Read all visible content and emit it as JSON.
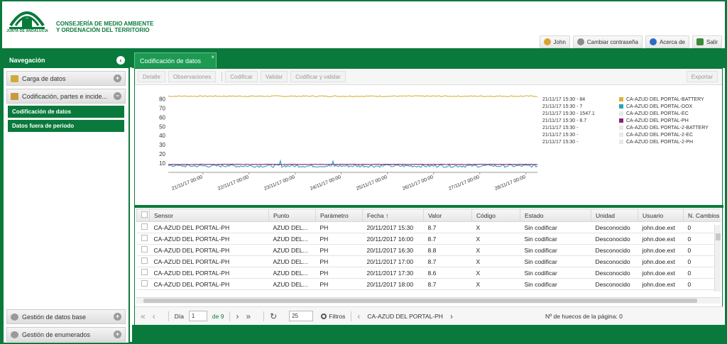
{
  "header": {
    "logo_caption": "JUNTA DE ANDALUCIA",
    "org_line1": "CONSEJERÍA DE MEDIO AMBIENTE",
    "org_line2": "Y ORDENACIÓN DEL TERRITORIO",
    "user": "John",
    "change_password": "Cambiar contraseña",
    "about": "Acerca de",
    "logout": "Salir"
  },
  "sidebar": {
    "title": "Navegación",
    "sections": [
      {
        "label": "Carga de datos",
        "state": "+"
      },
      {
        "label": "Codificación, partes e incide...",
        "state": "−"
      }
    ],
    "links": [
      "Codificación de datos",
      "Datos fuera de periodo"
    ],
    "bottom_sections": [
      {
        "label": "Gestión de datos base",
        "state": "+"
      },
      {
        "label": "Gestión de enumerados",
        "state": "+"
      }
    ]
  },
  "tab": {
    "label": "Codificación de datos",
    "close": "×"
  },
  "toolbar": {
    "detalle": "Detalle",
    "observaciones": "Observaciones",
    "codificar": "Codificar",
    "validar": "Validar",
    "codificar_validar": "Codificar y validar",
    "exportar": "Exportar"
  },
  "chart_data": {
    "type": "line",
    "y_ticks": [
      "80",
      "70",
      "60",
      "50",
      "40",
      "30",
      "20",
      "10"
    ],
    "ylim": [
      0,
      85
    ],
    "x_ticks": [
      "21/11/17 00:00",
      "22/11/17 00:00",
      "23/11/17 00:00",
      "24/11/17 00:00",
      "25/11/17 00:00",
      "26/11/17 00:00",
      "27/11/17 00:00",
      "28/11/17 00:00"
    ],
    "series": [
      {
        "name": "CA-AZUD DEL PORTAL-BATTERY",
        "last": "21/11/17 15:30 - 84",
        "color": "#d9b43a",
        "approx_level": 83
      },
      {
        "name": "CA-AZUD DEL PORTAL-DOX",
        "last": "21/11/17 15:30 - 7",
        "color": "#2e9fb8",
        "approx_level": 7
      },
      {
        "name": "CA-AZUD DEL PORTAL-EC",
        "last": "21/11/17 15:30 - 1547.1",
        "color": "#e8e8e8",
        "approx_level": null
      },
      {
        "name": "CA-AZUD DEL PORTAL-PH",
        "last": "21/11/17 15:30 - 8.7",
        "color": "#8b1f7a",
        "approx_level": 8.7
      },
      {
        "name": "CA-AZUD DEL PORTAL-2-BATTERY",
        "last": "21/11/17 15:30 -",
        "color": "#e8e8e8",
        "approx_level": null
      },
      {
        "name": "CA-AZUD DEL PORTAL-2-EC",
        "last": "21/11/17 15:30 -",
        "color": "#e8e8e8",
        "approx_level": null
      },
      {
        "name": "CA-AZUD DEL PORTAL-2-PH",
        "last": "21/11/17 15:30 -",
        "color": "#e8e8e8",
        "approx_level": null
      }
    ]
  },
  "grid": {
    "columns": [
      "Sensor",
      "Punto",
      "Parámetro",
      "Fecha ↑",
      "Valor",
      "Código",
      "Estado",
      "Unidad",
      "Usuario",
      "N. Cambios"
    ],
    "rows": [
      [
        "CA-AZUD DEL PORTAL-PH",
        "AZUD DEL...",
        "PH",
        "20/11/2017 15:30",
        "8.7",
        "X",
        "Sin codificar",
        "Desconocido",
        "john.doe.ext",
        "0"
      ],
      [
        "CA-AZUD DEL PORTAL-PH",
        "AZUD DEL...",
        "PH",
        "20/11/2017 16:00",
        "8.7",
        "X",
        "Sin codificar",
        "Desconocido",
        "john.doe.ext",
        "0"
      ],
      [
        "CA-AZUD DEL PORTAL-PH",
        "AZUD DEL...",
        "PH",
        "20/11/2017 16:30",
        "8.8",
        "X",
        "Sin codificar",
        "Desconocido",
        "john.doe.ext",
        "0"
      ],
      [
        "CA-AZUD DEL PORTAL-PH",
        "AZUD DEL...",
        "PH",
        "20/11/2017 17:00",
        "8.7",
        "X",
        "Sin codificar",
        "Desconocido",
        "john.doe.ext",
        "0"
      ],
      [
        "CA-AZUD DEL PORTAL-PH",
        "AZUD DEL...",
        "PH",
        "20/11/2017 17:30",
        "8.6",
        "X",
        "Sin codificar",
        "Desconocido",
        "john.doe.ext",
        "0"
      ],
      [
        "CA-AZUD DEL PORTAL-PH",
        "AZUD DEL...",
        "PH",
        "20/11/2017 18:00",
        "8.7",
        "X",
        "Sin codificar",
        "Desconocido",
        "john.doe.ext",
        "0"
      ]
    ]
  },
  "pager": {
    "first": "«",
    "prev": "‹",
    "page_label": "Día",
    "page_value": "1",
    "of": "de 9",
    "next": "›",
    "last": "»",
    "refresh": "↻",
    "page_size": "25",
    "filters": "Filtros",
    "sensor_prev": "‹",
    "sensor": "CA-AZUD DEL PORTAL-PH",
    "sensor_next": "›",
    "gaps": "Nº de huecos de la página: 0"
  }
}
